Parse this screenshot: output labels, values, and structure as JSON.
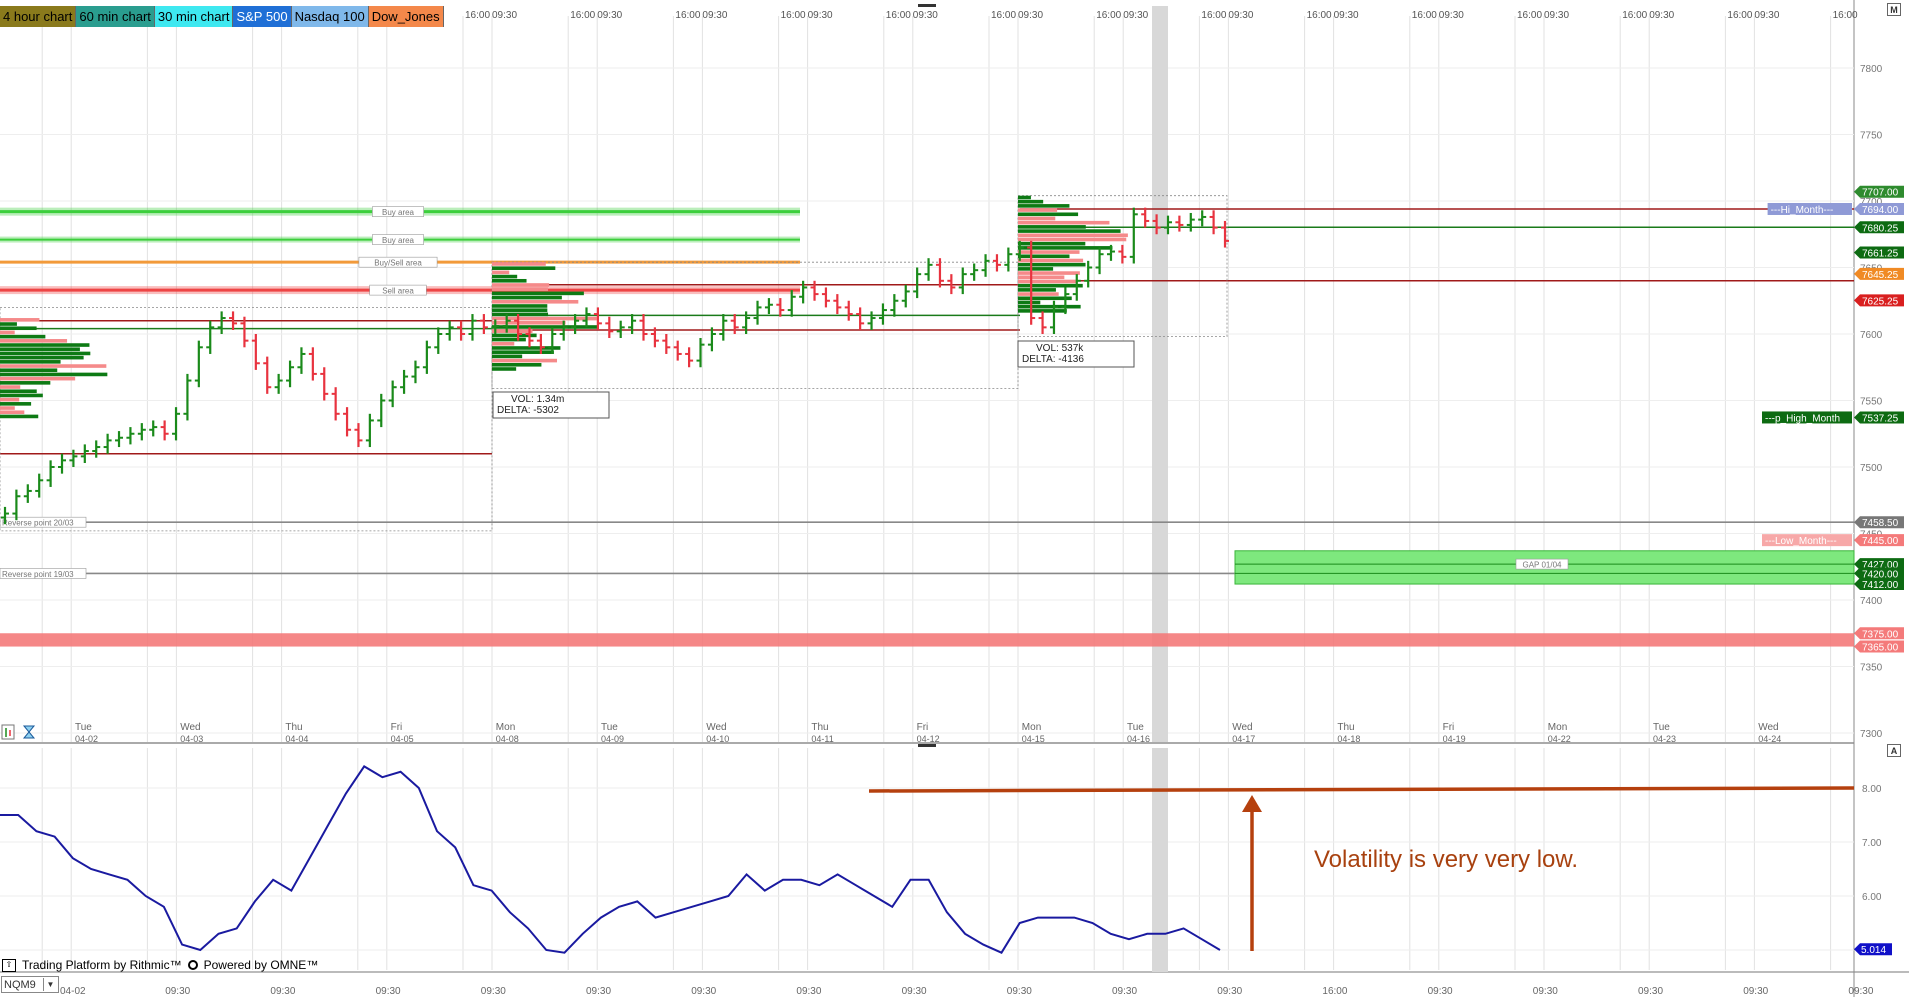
{
  "tabs": [
    {
      "label": "4 hour chart",
      "bg": "#8a7a1c"
    },
    {
      "label": "60 min chart",
      "bg": "#2a9d8f"
    },
    {
      "label": "30 min chart",
      "bg": "#3ee8f0"
    },
    {
      "label": "S&P 500",
      "bg": "#1f6fd6"
    },
    {
      "label": "Nasdaq 100",
      "bg": "#7fb8ea"
    },
    {
      "label": "Dow_Jones",
      "bg": "#f4884a"
    }
  ],
  "top_time_ticks": [
    "16:00",
    "09:30",
    "16:00",
    "09:30",
    "16:00",
    "09:30",
    "16:00",
    "09:30",
    "16:00",
    "09:30",
    "16:00",
    "09:30",
    "16:00",
    "09:30",
    "16:00",
    "09:30",
    "16:00",
    "09:30",
    "16:00",
    "09:30",
    "16:00",
    "09:30",
    "16:00",
    "09:30",
    "16:00",
    "09:30",
    "16:00",
    "09:30",
    "16:00",
    "09:30",
    "16:00",
    "09:30",
    "16:00",
    "09:30",
    "16:00",
    "09:30",
    "16:00",
    "09:30"
  ],
  "day_labels": [
    {
      "day": "Tue",
      "date": "04-02"
    },
    {
      "day": "Wed",
      "date": "04-03"
    },
    {
      "day": "Thu",
      "date": "04-04"
    },
    {
      "day": "Fri",
      "date": "04-05"
    },
    {
      "day": "Mon",
      "date": "04-08"
    },
    {
      "day": "Tue",
      "date": "04-09"
    },
    {
      "day": "Wed",
      "date": "04-10"
    },
    {
      "day": "Thu",
      "date": "04-11"
    },
    {
      "day": "Fri",
      "date": "04-12"
    },
    {
      "day": "Mon",
      "date": "04-15"
    },
    {
      "day": "Tue",
      "date": "04-16"
    },
    {
      "day": "Wed",
      "date": "04-17"
    },
    {
      "day": "Thu",
      "date": "04-18"
    },
    {
      "day": "Fri",
      "date": "04-19"
    },
    {
      "day": "Mon",
      "date": "04-22"
    },
    {
      "day": "Tue",
      "date": "04-23"
    },
    {
      "day": "Wed",
      "date": "04-24"
    }
  ],
  "bottom_time_ticks": [
    "04-02",
    "09:30",
    "09:30",
    "09:30",
    "09:30",
    "09:30",
    "09:30",
    "09:30",
    "09:30",
    "09:30",
    "09:30",
    "09:30",
    "16:00",
    "09:30",
    "09:30",
    "09:30",
    "09:30",
    "09:30"
  ],
  "price_axis": {
    "ticks": [
      "7800",
      "7750",
      "7700",
      "7650",
      "7600",
      "7550",
      "7500",
      "7450",
      "7400",
      "7350",
      "7300"
    ],
    "range": [
      7300,
      7800
    ]
  },
  "indicator_axis": {
    "ticks": [
      "8.00",
      "7.00",
      "6.00",
      "5.00"
    ],
    "range": [
      4.6,
      8.4
    ]
  },
  "price_tags": [
    {
      "text": "7707.00",
      "value": 7707.0,
      "bg": "#2e8b2e"
    },
    {
      "text": "7694.00",
      "value": 7694.0,
      "bg": "#8f9ad6"
    },
    {
      "text": "7680.25",
      "value": 7680.25,
      "bg": "#0d6b12"
    },
    {
      "text": "7661.25",
      "value": 7661.25,
      "bg": "#0d6b12"
    },
    {
      "text": "7645.25",
      "value": 7645.25,
      "bg": "#f08a24"
    },
    {
      "text": "7625.25",
      "value": 7625.25,
      "bg": "#d91f1f"
    },
    {
      "text": "7537.25",
      "value": 7537.25,
      "bg": "#0d6b12"
    },
    {
      "text": "7458.50",
      "value": 7458.5,
      "bg": "#777777"
    },
    {
      "text": "7445.00",
      "value": 7445.0,
      "bg": "#f47a7a"
    },
    {
      "text": "7427.00",
      "value": 7427.0,
      "bg": "#0d6b12"
    },
    {
      "text": "7420.00",
      "value": 7420.0,
      "bg": "#0d6b12"
    },
    {
      "text": "7412.00",
      "value": 7412.0,
      "bg": "#0d6b12"
    },
    {
      "text": "7375.00",
      "value": 7375.0,
      "bg": "#f47a7a"
    },
    {
      "text": "7365.00",
      "value": 7365.0,
      "bg": "#f47a7a"
    }
  ],
  "indicator_tag": {
    "text": "5.014",
    "value": 5.014,
    "bg": "#1010c8"
  },
  "level_labels": [
    {
      "text": "Buy area",
      "value": 7692,
      "color": "#3ccf3c"
    },
    {
      "text": "Buy area",
      "value": 7671,
      "color": "#3ccf3c"
    },
    {
      "text": "Buy/Sell area",
      "value": 7654,
      "color": "#f29a3a"
    },
    {
      "text": "Sell area",
      "value": 7633,
      "color": "#ee4444"
    },
    {
      "text": "Reverse point 20/03",
      "value": 7458.5,
      "color": "#888888"
    },
    {
      "text": "Reverse point 19/03",
      "value": 7420,
      "color": "#888888"
    },
    {
      "text": "GAP 01/04",
      "value": 7427,
      "color": "#2fbf2f"
    }
  ],
  "axis_line_labels": [
    {
      "text": "---Hi_Month---",
      "value": 7694,
      "bg": "#8f9ad6"
    },
    {
      "text": "---p_High_Month",
      "value": 7537.25,
      "bg": "#0d6b12"
    },
    {
      "text": "---Low_Month---",
      "value": 7445,
      "bg": "#f7a8a8"
    }
  ],
  "volume_boxes": [
    {
      "vol": "VOL: 1.34m",
      "delta": "DELTA: -5302"
    },
    {
      "vol": "VOL: 537k",
      "delta": "DELTA: -4136"
    }
  ],
  "annotation": "Volatility is very very low.",
  "status": {
    "left": "Trading Platform by Rithmic™",
    "right": "Powered by OMNE™"
  },
  "symbol": "NQM9",
  "corner": {
    "top": "M",
    "mid": "A"
  },
  "colors": {
    "up": "#1a8a1a",
    "down": "#e8333f",
    "indicator": "#1a1aa0",
    "arrow": "#b5400e"
  }
}
